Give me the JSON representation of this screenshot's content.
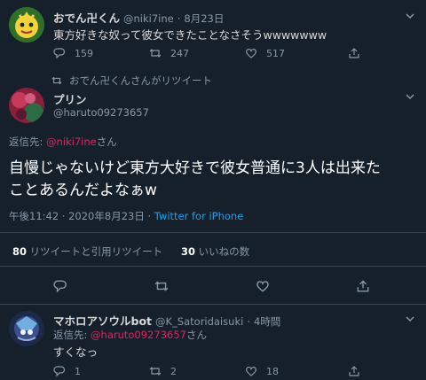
{
  "tweet1": {
    "display_name": "おでん卍くん",
    "handle": "@niki7ine",
    "separator": "·",
    "date": "8月23日",
    "text": "東方好きな奴って彼女できたことなさそうwwwwwww",
    "reply_count": "159",
    "retweet_count": "247",
    "like_count": "517"
  },
  "retweet_context": {
    "text": "おでん卍くんさんがリツイート"
  },
  "main_tweet": {
    "display_name": "プリン",
    "handle": "@haruto09273657",
    "reply_prefix": "返信先: ",
    "reply_to": "@niki7ine",
    "reply_suffix": "さん",
    "text_line1": "自慢じゃないけど東方大好きで彼女普通に3人は出来た",
    "text_line2": "ことあるんだよなぁw",
    "timestamp": "午後11:42 · 2020年8月23日 · ",
    "source": "Twitter for iPhone",
    "retweet_stat_count": "80",
    "retweet_stat_label": "リツイートと引用リツイート",
    "like_stat_count": "30",
    "like_stat_label": "いいねの数"
  },
  "reply_tweet": {
    "display_name": "マホロアソウルbot",
    "handle": "@K_Satoridaisuki",
    "separator": "·",
    "time": "4時間",
    "reply_prefix": "返信先: ",
    "reply_to": "@haruto09273657",
    "reply_suffix": "さん",
    "text": "すくなっ",
    "reply_count": "1",
    "retweet_count": "2",
    "like_count": "18"
  },
  "colors": {
    "background": "#15202b",
    "muted": "#8899a6",
    "mention": "#e0245e",
    "link": "#1da1f2",
    "divider": "#38444d"
  },
  "icons": [
    "reply-icon",
    "retweet-icon",
    "like-icon",
    "share-icon",
    "chevron-down-icon"
  ]
}
